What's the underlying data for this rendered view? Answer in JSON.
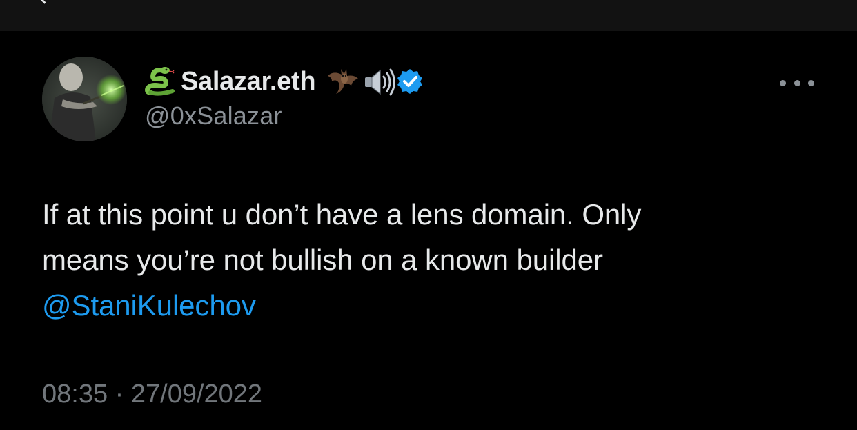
{
  "tweet": {
    "author": {
      "display_name": "Salazar.eth",
      "handle": "@0xSalazar",
      "verified": true,
      "name_emojis": [
        "snake-emoji",
        "bat-emoji",
        "speaker-emoji"
      ],
      "verified_color": "#1d9bf0"
    },
    "text_lines": [
      "If at this point u don’t have a lens domain. Only",
      "means you’re not bullish on a known builder"
    ],
    "mention": "@StaniKulechov",
    "timestamp": "08:35 · 27/09/2022"
  },
  "colors": {
    "background": "#000000",
    "top_bar": "#121212",
    "text": "#e7e9ea",
    "secondary": "#71767b",
    "link": "#1d9bf0"
  }
}
